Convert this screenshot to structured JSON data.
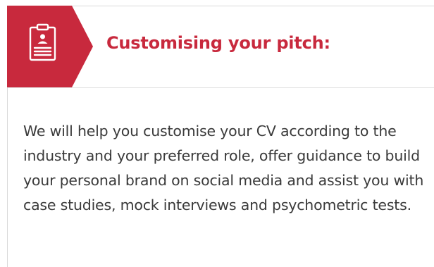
{
  "section": {
    "title": "Customising your pitch:",
    "body": "We will help you customise your CV according to the industry and your preferred role, offer guidance to build your personal brand on social media and assist you with case studies, mock interviews and psychometric tests.",
    "icon": "cv-document-icon"
  },
  "colors": {
    "accent": "#c8293d",
    "text": "#3a3a3a",
    "border": "#d9d9d9"
  }
}
